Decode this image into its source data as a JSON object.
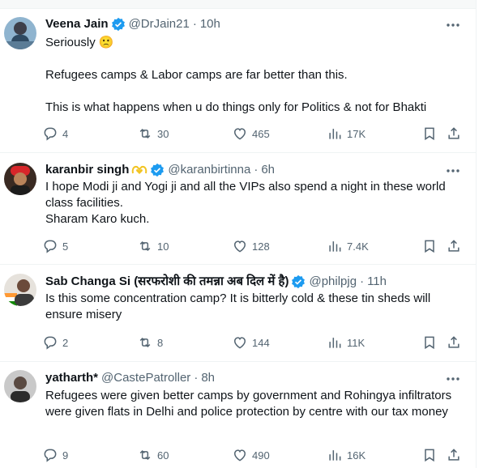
{
  "tweets": [
    {
      "name": "Veena Jain",
      "handle": "@DrJain21",
      "time": "10h",
      "text": "Seriously 🙁\n\nRefugees camps & Labor camps are far better than this.\n\nThis is what happens when u do things only for Politics & not for Bhakti",
      "replies": "4",
      "reposts": "30",
      "likes": "465",
      "views": "17K"
    },
    {
      "name": "karanbir singh",
      "handle": "@karanbirtinna",
      "time": "6h",
      "text": "I hope Modi ji and Yogi ji and all the VIPs also spend a night in these world class facilities.\nSharam Karo kuch.",
      "replies": "5",
      "reposts": "10",
      "likes": "128",
      "views": "7.4K"
    },
    {
      "name": "Sab Changa Si (सरफरोशी की तमन्ना अब दिल में है)",
      "handle": "@philpjg",
      "time": "11h",
      "text": "Is this some concentration camp? It is bitterly cold & these tin sheds will ensure misery",
      "replies": "2",
      "reposts": "8",
      "likes": "144",
      "views": "11K"
    },
    {
      "name": "yatharth*",
      "handle": "@CastePatroller",
      "time": "8h",
      "text": "Refugees were given better camps by government and Rohingya infiltrators were given flats in Delhi and police protection by centre with our tax money",
      "replies": "9",
      "reposts": "60",
      "likes": "490",
      "views": "16K"
    }
  ],
  "colors": {
    "verified": "#1d9bf0",
    "muted": "#536471",
    "text": "#0f1419",
    "divider": "#eff3f4"
  },
  "icons": [
    "verified-badge-icon",
    "more-icon",
    "reply-icon",
    "repost-icon",
    "like-icon",
    "views-icon",
    "bookmark-icon",
    "share-icon",
    "yellow-heart-hands-icon"
  ]
}
